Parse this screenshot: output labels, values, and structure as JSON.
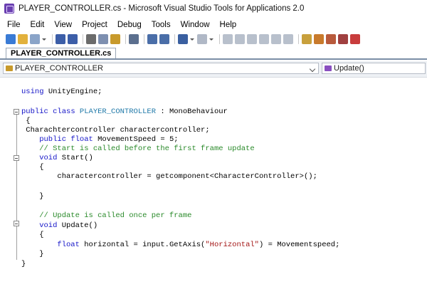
{
  "window": {
    "title": "PLAYER_CONTROLLER.cs - Microsoft Visual Studio Tools for Applications 2.0",
    "app_icon": "vsta-icon"
  },
  "menu": [
    "File",
    "Edit",
    "View",
    "Project",
    "Debug",
    "Tools",
    "Window",
    "Help"
  ],
  "toolbar": {
    "buttons": [
      {
        "name": "add-item-icon",
        "color": "#3a7bd5"
      },
      {
        "name": "open-icon",
        "color": "#e2b13c"
      },
      {
        "name": "add-project-icon",
        "color": "#8aa4c8"
      },
      {
        "name": "save-icon",
        "color": "#3c5ea8"
      },
      {
        "name": "save-all-icon",
        "color": "#3c5ea8"
      },
      {
        "name": "cut-icon",
        "color": "#6b6b6b"
      },
      {
        "name": "copy-icon",
        "color": "#7d8fb0"
      },
      {
        "name": "paste-icon",
        "color": "#c89a2c"
      },
      {
        "name": "find-icon",
        "color": "#5b6f8e"
      },
      {
        "name": "indent-icon",
        "color": "#4a6ea8"
      },
      {
        "name": "outdent-icon",
        "color": "#4a6ea8"
      },
      {
        "name": "undo-icon",
        "color": "#3a5fa0"
      },
      {
        "name": "redo-icon",
        "color": "#b0b8c6"
      },
      {
        "name": "start-icon",
        "color": "#b8c0cc"
      },
      {
        "name": "pause-icon",
        "color": "#b8c0cc"
      },
      {
        "name": "stop-icon",
        "color": "#b8c0cc"
      },
      {
        "name": "step-into-icon",
        "color": "#b8c0cc"
      },
      {
        "name": "step-over-icon",
        "color": "#b8c0cc"
      },
      {
        "name": "step-out-icon",
        "color": "#b8c0cc"
      },
      {
        "name": "project-explorer-icon",
        "color": "#c8a03c"
      },
      {
        "name": "properties-icon",
        "color": "#c87a2c"
      },
      {
        "name": "object-browser-icon",
        "color": "#b85a3c"
      },
      {
        "name": "toolbox-icon",
        "color": "#a04040"
      },
      {
        "name": "options-icon",
        "color": "#c83c3c"
      }
    ]
  },
  "tab": {
    "label": "PLAYER_CONTROLLER.cs"
  },
  "navbar": {
    "class_selector": "PLAYER_CONTROLLER",
    "member_selector": "Update()"
  },
  "code": [
    {
      "segments": [
        {
          "t": "using ",
          "c": "kw"
        },
        {
          "t": "UnityEngine;",
          "c": ""
        }
      ]
    },
    {
      "segments": []
    },
    {
      "segments": [
        {
          "t": "public ",
          "c": "kw"
        },
        {
          "t": "class ",
          "c": "kw"
        },
        {
          "t": "PLAYER_CONTROLLER",
          "c": "ty"
        },
        {
          "t": " : MonoBehaviour",
          "c": ""
        }
      ]
    },
    {
      "segments": [
        {
          "t": " {",
          "c": ""
        }
      ]
    },
    {
      "segments": [
        {
          "t": " Charachtercontroller charactercontroller;",
          "c": ""
        }
      ]
    },
    {
      "segments": [
        {
          "t": "    public ",
          "c": "kw"
        },
        {
          "t": "float ",
          "c": "kw"
        },
        {
          "t": "MovementSpeed = 5;",
          "c": ""
        }
      ]
    },
    {
      "segments": [
        {
          "t": "    // Start is called before the first frame update",
          "c": "cm"
        }
      ]
    },
    {
      "segments": [
        {
          "t": "    void ",
          "c": "kw"
        },
        {
          "t": "Start()",
          "c": ""
        }
      ]
    },
    {
      "segments": [
        {
          "t": "    {",
          "c": ""
        }
      ]
    },
    {
      "segments": []
    },
    {
      "segments": [
        {
          "t": "        charactercontroller = getcomponent<CharacterController>();",
          "c": ""
        }
      ]
    },
    {
      "segments": []
    },
    {
      "segments": [
        {
          "t": "    }",
          "c": ""
        }
      ]
    },
    {
      "segments": []
    },
    {
      "segments": [
        {
          "t": "    // Update is called once per frame",
          "c": "cm"
        }
      ]
    },
    {
      "segments": [
        {
          "t": "    void ",
          "c": "kw"
        },
        {
          "t": "Update()",
          "c": ""
        }
      ]
    },
    {
      "segments": [
        {
          "t": "    {",
          "c": ""
        }
      ]
    },
    {
      "segments": [
        {
          "t": "        float ",
          "c": "kw"
        },
        {
          "t": "horizontal = input.GetAxis(",
          "c": ""
        },
        {
          "t": "\"Horizontal\"",
          "c": "st"
        },
        {
          "t": ") = Movementspeed;",
          "c": ""
        }
      ]
    },
    {
      "segments": [
        {
          "t": "    }",
          "c": ""
        }
      ]
    },
    {
      "segments": [
        {
          "t": "}",
          "c": ""
        }
      ]
    }
  ]
}
